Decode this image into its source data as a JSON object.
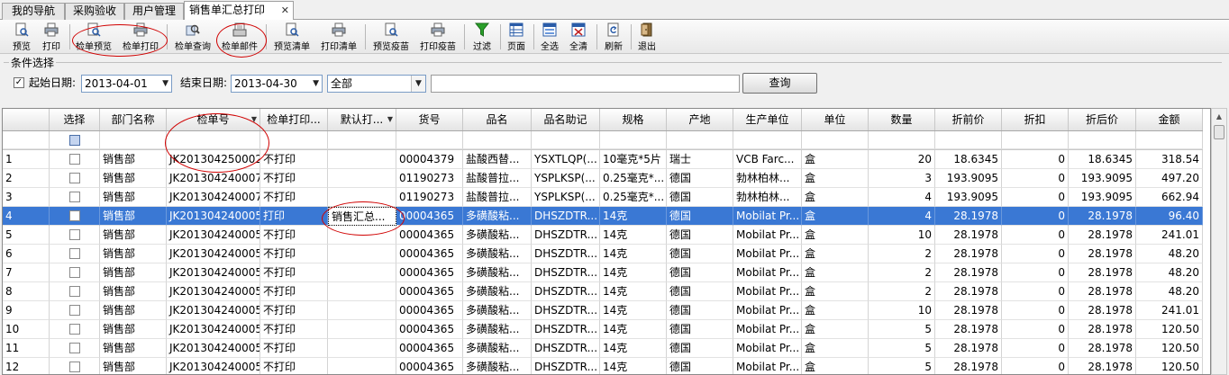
{
  "tabs": [
    {
      "label": "我的导航"
    },
    {
      "label": "采购验收"
    },
    {
      "label": "用户管理"
    },
    {
      "label": "销售单汇总打印",
      "active": true
    }
  ],
  "tab_close_glyph": "✕",
  "toolbar": [
    {
      "label": "预览",
      "icon": "preview-icon"
    },
    {
      "label": "打印",
      "icon": "printer-icon"
    },
    {
      "label": "检单预览",
      "icon": "preview-icon"
    },
    {
      "label": "检单打印",
      "icon": "printer-icon"
    },
    {
      "label": "检单查询",
      "icon": "query-icon"
    },
    {
      "label": "检单邮件",
      "icon": "mail-icon"
    },
    {
      "label": "预览清单",
      "icon": "preview-icon"
    },
    {
      "label": "打印清单",
      "icon": "printer-icon"
    },
    {
      "label": "预览疫苗",
      "icon": "preview-icon"
    },
    {
      "label": "打印疫苗",
      "icon": "printer-icon"
    },
    {
      "label": "过滤",
      "icon": "filter-icon"
    },
    {
      "label": "页面",
      "icon": "page-icon"
    },
    {
      "label": "全选",
      "icon": "select-all-icon"
    },
    {
      "label": "全清",
      "icon": "clear-all-icon"
    },
    {
      "label": "刷新",
      "icon": "refresh-icon"
    },
    {
      "label": "退出",
      "icon": "exit-icon"
    }
  ],
  "conditions": {
    "group_title": "条件选择",
    "start_checked_glyph": "✓",
    "start_label": "起始日期:",
    "start_date": "2013-04-01",
    "end_label": "结束日期:",
    "end_date": "2013-04-30",
    "dropdown_glyph": "▼",
    "scope_value": "全部",
    "keyword_value": "",
    "query_button": "查询"
  },
  "grid": {
    "sort_glyph": "▼",
    "columns": [
      "",
      "选择",
      "部门名称",
      "检单号",
      "检单打印...",
      "默认打...",
      "货号",
      "品名",
      "品名助记",
      "规格",
      "产地",
      "生产单位",
      "单位",
      "数量",
      "折前价",
      "折扣",
      "折后价",
      "金额"
    ],
    "rows": [
      [
        "1",
        "",
        "销售部",
        "JK201304250002",
        "不打印",
        "",
        "00004379",
        "盐酸西替...",
        "YSXTLQP(...",
        "10毫克*5片",
        "瑞士",
        "VCB  Farc...",
        "盒",
        "20",
        "18.6345",
        "0",
        "18.6345",
        "318.54"
      ],
      [
        "2",
        "",
        "销售部",
        "JK201304240007",
        "不打印",
        "",
        "01190273",
        "盐酸普拉...",
        "YSPLKSP(...",
        "0.25毫克*...",
        "德国",
        "勃林柏林...",
        "盒",
        "3",
        "193.9095",
        "0",
        "193.9095",
        "497.20"
      ],
      [
        "3",
        "",
        "销售部",
        "JK201304240007",
        "不打印",
        "",
        "01190273",
        "盐酸普拉...",
        "YSPLKSP(...",
        "0.25毫克*...",
        "德国",
        "勃林柏林...",
        "盒",
        "4",
        "193.9095",
        "0",
        "193.9095",
        "662.94"
      ],
      [
        "4",
        "",
        "销售部",
        "JK201304240005",
        "打印",
        "销售汇总...",
        "00004365",
        "多磺酸粘...",
        "DHSZDTR...",
        "14克",
        "德国",
        "Mobilat Pr...",
        "盒",
        "4",
        "28.1978",
        "0",
        "28.1978",
        "96.40"
      ],
      [
        "5",
        "",
        "销售部",
        "JK201304240005",
        "不打印",
        "",
        "00004365",
        "多磺酸粘...",
        "DHSZDTR...",
        "14克",
        "德国",
        "Mobilat Pr...",
        "盒",
        "10",
        "28.1978",
        "0",
        "28.1978",
        "241.01"
      ],
      [
        "6",
        "",
        "销售部",
        "JK201304240005",
        "不打印",
        "",
        "00004365",
        "多磺酸粘...",
        "DHSZDTR...",
        "14克",
        "德国",
        "Mobilat Pr...",
        "盒",
        "2",
        "28.1978",
        "0",
        "28.1978",
        "48.20"
      ],
      [
        "7",
        "",
        "销售部",
        "JK201304240005",
        "不打印",
        "",
        "00004365",
        "多磺酸粘...",
        "DHSZDTR...",
        "14克",
        "德国",
        "Mobilat Pr...",
        "盒",
        "2",
        "28.1978",
        "0",
        "28.1978",
        "48.20"
      ],
      [
        "8",
        "",
        "销售部",
        "JK201304240005",
        "不打印",
        "",
        "00004365",
        "多磺酸粘...",
        "DHSZDTR...",
        "14克",
        "德国",
        "Mobilat Pr...",
        "盒",
        "2",
        "28.1978",
        "0",
        "28.1978",
        "48.20"
      ],
      [
        "9",
        "",
        "销售部",
        "JK201304240005",
        "不打印",
        "",
        "00004365",
        "多磺酸粘...",
        "DHSZDTR...",
        "14克",
        "德国",
        "Mobilat Pr...",
        "盒",
        "10",
        "28.1978",
        "0",
        "28.1978",
        "241.01"
      ],
      [
        "10",
        "",
        "销售部",
        "JK201304240005",
        "不打印",
        "",
        "00004365",
        "多磺酸粘...",
        "DHSZDTR...",
        "14克",
        "德国",
        "Mobilat Pr...",
        "盒",
        "5",
        "28.1978",
        "0",
        "28.1978",
        "120.50"
      ],
      [
        "11",
        "",
        "销售部",
        "JK201304240005",
        "不打印",
        "",
        "00004365",
        "多磺酸粘...",
        "DHSZDTR...",
        "14克",
        "德国",
        "Mobilat Pr...",
        "盒",
        "5",
        "28.1978",
        "0",
        "28.1978",
        "120.50"
      ],
      [
        "12",
        "",
        "销售部",
        "JK201304240005",
        "不打印",
        "",
        "00004365",
        "多磺酸粘...",
        "DHSZDTR...",
        "14克",
        "德国",
        "Mobilat Pr...",
        "盒",
        "5",
        "28.1978",
        "0",
        "28.1978",
        "120.50"
      ]
    ],
    "selected_row": 4
  },
  "scrollbar_up_glyph": "▲",
  "colors": {
    "selection": "#3a78d4",
    "annotation": "#d00000",
    "filter_icon": "#2aa02a"
  }
}
